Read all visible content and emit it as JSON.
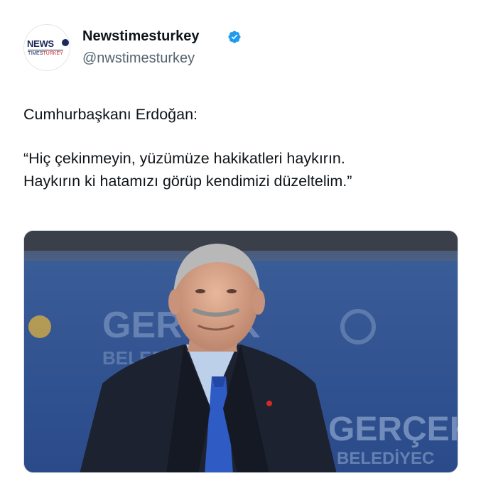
{
  "account": {
    "display_name": "Newstimesturkey",
    "handle": "@nwstimesturkey",
    "verified_icon": "verified-badge-icon",
    "avatar_logo_top": "NEWS",
    "avatar_logo_bottom_left": "TIMES",
    "avatar_logo_bottom_right": "TURKEY"
  },
  "tweet": {
    "line1": "Cumhurbaşkanı Erdoğan:",
    "line2": "“Hiç çekinmeyin, yüzümüze hakikatleri haykırın.",
    "line3": "Haykırın ki hatamızı görüp kendimizi düzeltelim.”"
  },
  "media": {
    "backdrop_word_1": "GERÇEK",
    "backdrop_word_2": "BELEDİYECİLİK",
    "backdrop_word_3": "GERÇEK",
    "backdrop_word_4": "BELEDİYEC"
  },
  "colors": {
    "verified_blue": "#1d9bf0",
    "backdrop_blue": "#2b4a86",
    "handle_gray": "#536471"
  }
}
